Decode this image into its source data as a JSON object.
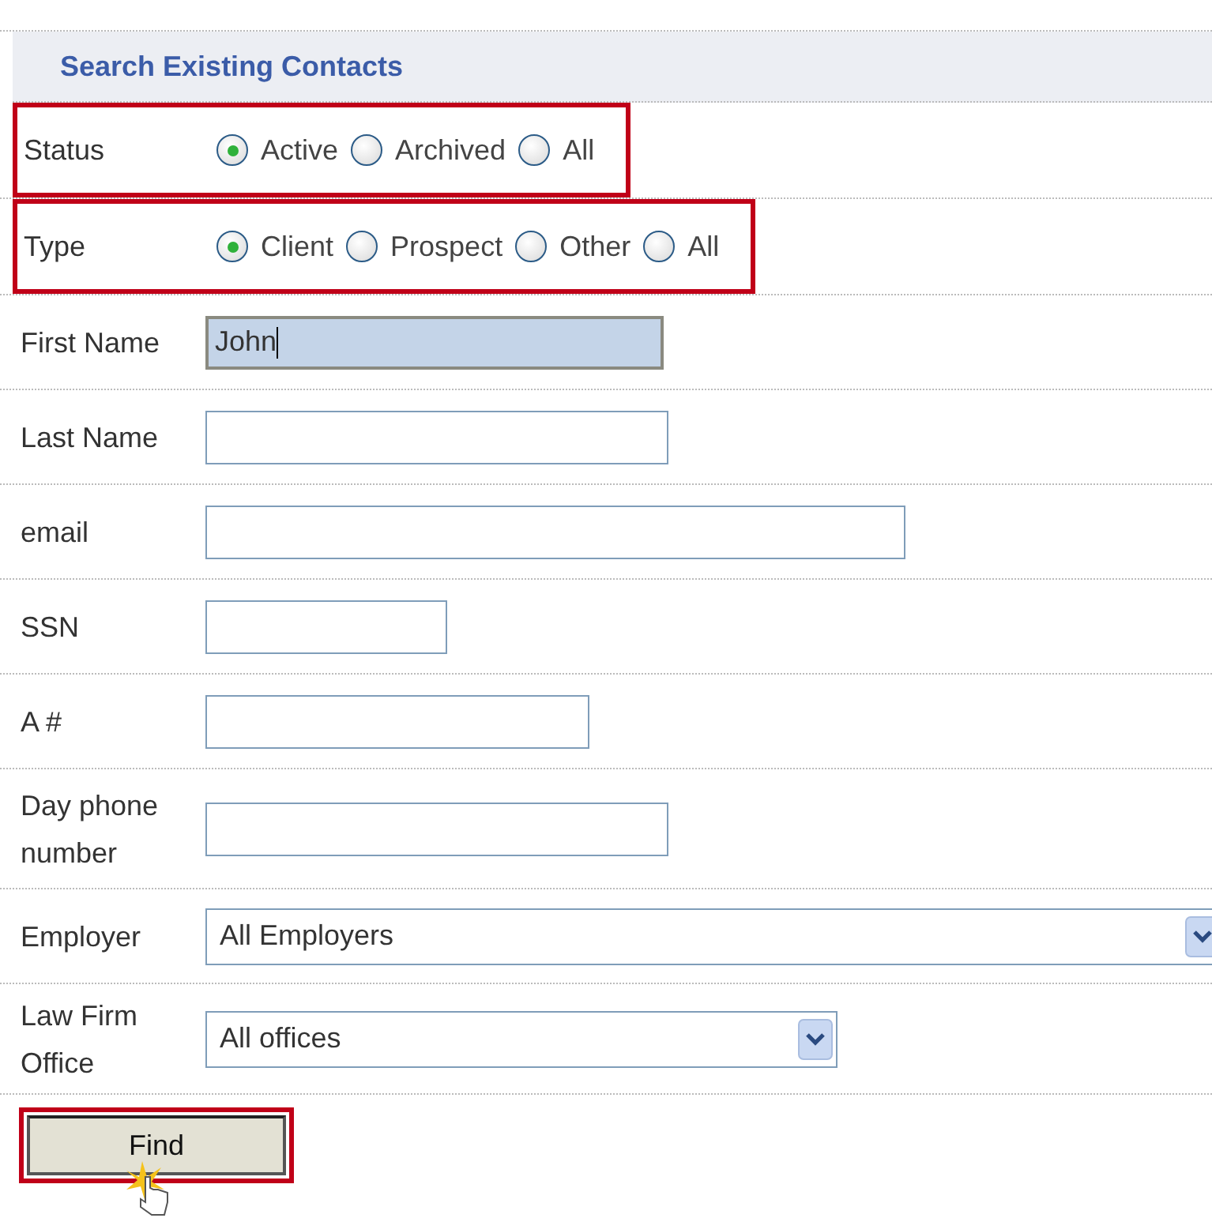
{
  "section": {
    "title": "Search Existing Contacts"
  },
  "radio_groups": [
    {
      "label": "Status",
      "highlighted": true,
      "options": [
        {
          "label": "Active",
          "selected": true
        },
        {
          "label": "Archived",
          "selected": false
        },
        {
          "label": "All",
          "selected": false
        }
      ]
    },
    {
      "label": "Type",
      "highlighted": true,
      "options": [
        {
          "label": "Client",
          "selected": true
        },
        {
          "label": "Prospect",
          "selected": false
        },
        {
          "label": "Other",
          "selected": false
        },
        {
          "label": "All",
          "selected": false
        }
      ]
    }
  ],
  "fields": [
    {
      "kind": "text",
      "label": "First Name",
      "value": "John",
      "focused": true
    },
    {
      "kind": "text",
      "label": "Last Name",
      "focused": false
    },
    {
      "kind": "text",
      "label": "email",
      "focused": false
    },
    {
      "kind": "text",
      "label": "SSN",
      "focused": false
    },
    {
      "kind": "text",
      "label": "A #",
      "focused": false
    },
    {
      "kind": "text",
      "label": "Day phone number",
      "focused": false
    },
    {
      "kind": "select",
      "label": "Employer",
      "value": "All Employers"
    },
    {
      "kind": "select",
      "label": "Law Firm Office",
      "value": "All offices"
    }
  ],
  "find_button": {
    "label": "Find",
    "highlighted": true
  }
}
